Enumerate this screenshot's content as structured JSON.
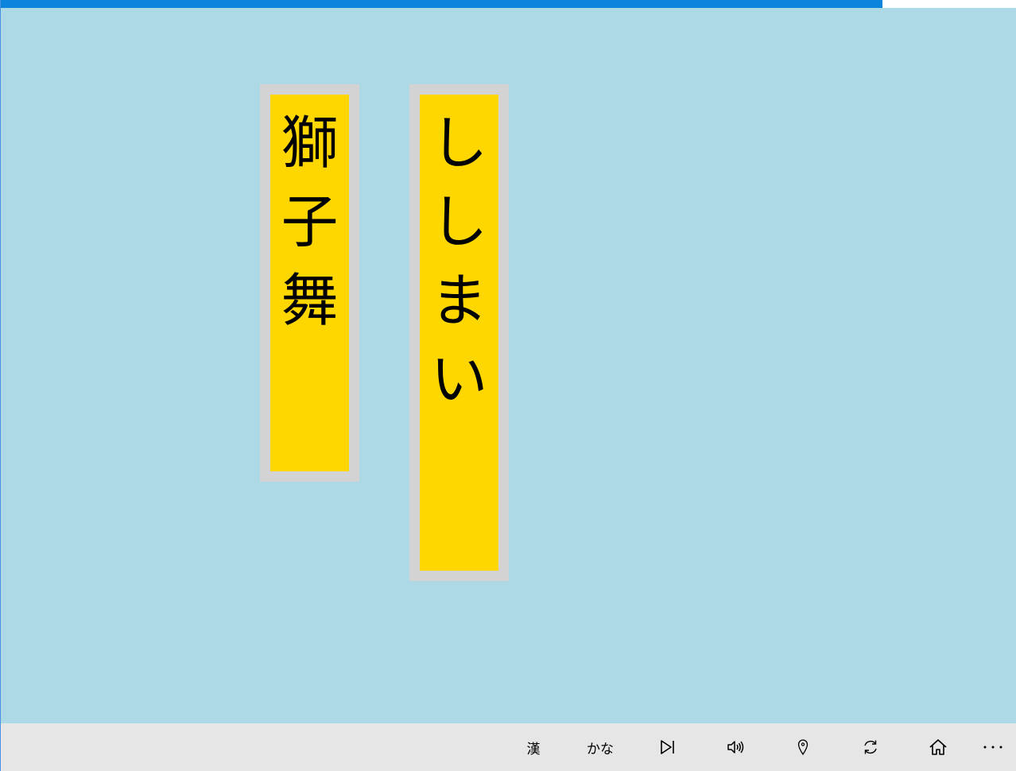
{
  "progress": {
    "value": 0.868,
    "color": "#0a84dc"
  },
  "cards": [
    {
      "name": "kanji-card",
      "chars": [
        "獅",
        "子",
        "舞"
      ]
    },
    {
      "name": "kana-card",
      "chars": [
        "し",
        "し",
        "ま",
        "い"
      ]
    }
  ],
  "colors": {
    "background": "#add8e6",
    "card_border": "#d3d3d3",
    "card_fill": "#ffd700",
    "bottom_bar": "#e6e6e6"
  },
  "toolbar": {
    "kanji_label": "漢",
    "kana_label": "かな",
    "buttons": [
      {
        "name": "kanji-toggle-button",
        "icon": null
      },
      {
        "name": "kana-toggle-button",
        "icon": null
      },
      {
        "name": "next-button",
        "icon": "skip-next-icon"
      },
      {
        "name": "speak-button",
        "icon": "speaker-icon"
      },
      {
        "name": "location-button",
        "icon": "map-pin-icon"
      },
      {
        "name": "refresh-button",
        "icon": "refresh-icon"
      },
      {
        "name": "home-button",
        "icon": "home-icon"
      },
      {
        "name": "more-button",
        "icon": "more-icon"
      }
    ]
  }
}
